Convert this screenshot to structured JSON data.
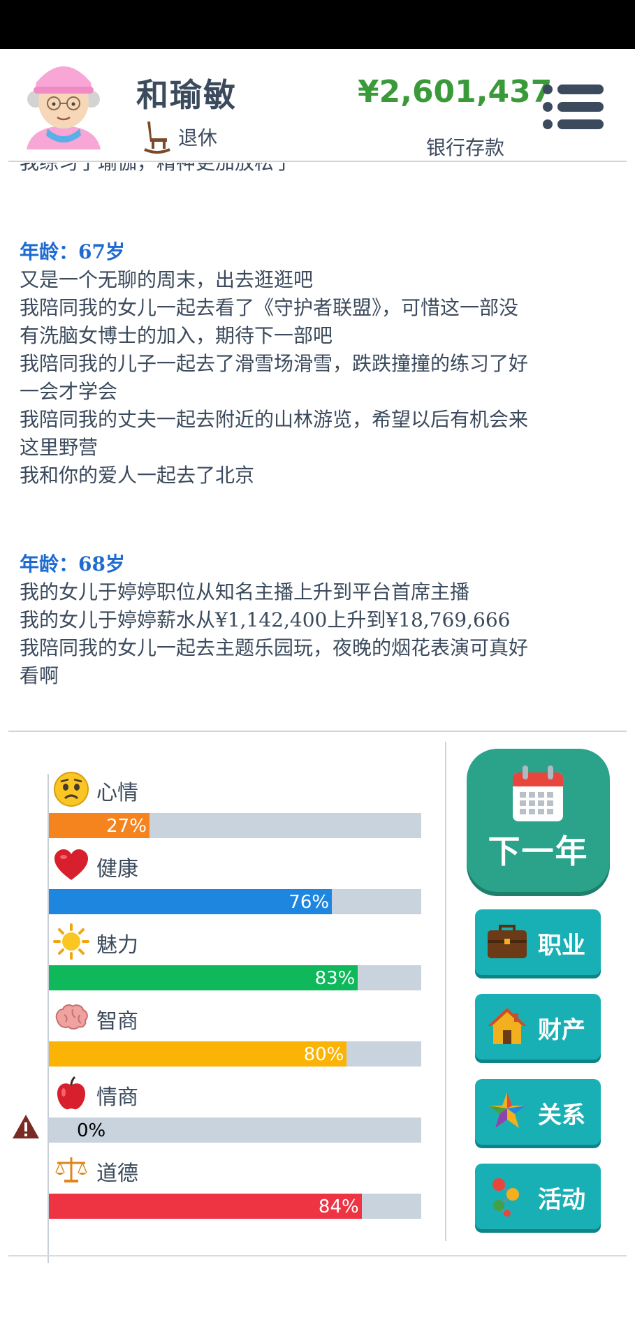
{
  "header": {
    "name": "和瑜敏",
    "job": "退休",
    "money": "¥2,601,437",
    "money_label": "银行存款"
  },
  "log": {
    "cut_line": "我练习了瑜伽，精神更加放松了",
    "entries": [
      {
        "age": "年龄：67岁",
        "lines": [
          "又是一个无聊的周末，出去逛逛吧",
          "我陪同我的女儿一起去看了《守护者联盟》，可惜这一部没",
          "有洗脑女博士的加入，期待下一部吧",
          "我陪同我的儿子一起去了滑雪场滑雪，跌跌撞撞的练习了好",
          "一会才学会",
          "我陪同我的丈夫一起去附近的山林游览，希望以后有机会来",
          "这里野营",
          "我和你的爱人一起去了北京"
        ]
      },
      {
        "age": "年龄：68岁",
        "lines": [
          "我的女儿于婷婷职位从知名主播上升到平台首席主播",
          "我的女儿于婷婷薪水从¥1,142,400上升到¥18,769,666",
          "我陪同我的女儿一起去主题乐园玩，夜晚的烟花表演可真好",
          "看啊"
        ]
      }
    ]
  },
  "stats": [
    {
      "name": "心情",
      "value_text": "27%",
      "value": 27,
      "color": "#f5841f",
      "icon": "sad-face-icon"
    },
    {
      "name": "健康",
      "value_text": "76%",
      "value": 76,
      "color": "#1f86e0",
      "icon": "heart-icon"
    },
    {
      "name": "魅力",
      "value_text": "83%",
      "value": 83,
      "color": "#0fb85a",
      "icon": "sun-icon"
    },
    {
      "name": "智商",
      "value_text": "80%",
      "value": 80,
      "color": "#fbb305",
      "icon": "brain-icon"
    },
    {
      "name": "情商",
      "value_text": "0%",
      "value": 0,
      "color": "#e82330",
      "icon": "apple-icon"
    },
    {
      "name": "道德",
      "value_text": "84%",
      "value": 84,
      "color": "#ee3342",
      "icon": "scale-icon"
    }
  ],
  "buttons": {
    "next_year": "下一年",
    "career": "职业",
    "property": "财产",
    "relations": "关系",
    "activity": "活动"
  }
}
